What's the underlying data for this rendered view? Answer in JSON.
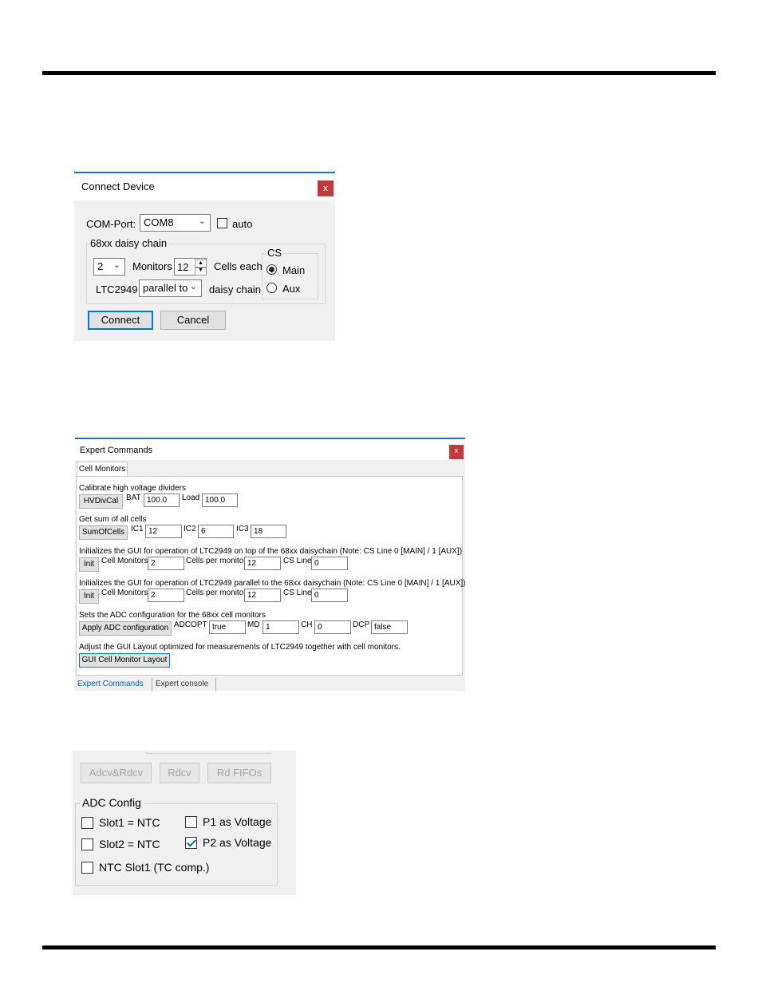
{
  "connect_device": {
    "title": "Connect Device",
    "close": "x",
    "com_port_label": "COM-Port:",
    "com_port_value": "COM8",
    "auto_label": "auto",
    "auto_checked": false,
    "daisy_group_label": "68xx daisy chain",
    "monitors_value": "2",
    "monitors_label": "Monitors",
    "cells_value": "12",
    "cells_label": "Cells each",
    "ltc_label": "LTC2949",
    "ltc_mode_value": "parallel to",
    "daisy_chain_label": "daisy chain",
    "cs_group_label": "CS",
    "cs_main_label": "Main",
    "cs_aux_label": "Aux",
    "cs_selected": "Main",
    "connect_button": "Connect",
    "cancel_button": "Cancel"
  },
  "expert_commands": {
    "title": "Expert Commands",
    "close": "x",
    "tab_cell_monitors": "Cell Monitors",
    "hvdiv": {
      "desc": "Calibrate high voltage dividers",
      "button": "HVDivCal",
      "bat_label": "BAT",
      "bat_value": "100.0",
      "load_label": "Load",
      "load_value": "100.0"
    },
    "sum": {
      "desc": "Get sum of all cells",
      "button": "SumOfCells",
      "ic1_label": "IC1",
      "ic1_value": "12",
      "ic2_label": "IC2",
      "ic2_value": "6",
      "ic3_label": "IC3",
      "ic3_value": "18"
    },
    "init_top": {
      "desc": "Initializes the GUI for operation of LTC2949 on top of the 68xx daisychain (Note: CS Line 0 [MAIN] / 1 [AUX])",
      "button": "Init",
      "cell_monitors_label": "Cell Monitors",
      "cell_monitors_value": "2",
      "cells_per_monitor_label": "Cells per monitor",
      "cells_per_monitor_value": "12",
      "cs_line_label": "CS Line",
      "cs_line_value": "0"
    },
    "init_parallel": {
      "desc": "Initializes the GUI for operation of LTC2949 parallel to the 68xx daisychain (Note: CS Line 0 [MAIN] / 1 [AUX])",
      "button": "Init",
      "cell_monitors_label": "Cell Monitors",
      "cell_monitors_value": "2",
      "cells_per_monitor_label": "Cells per monitor",
      "cells_per_monitor_value": "12",
      "cs_line_label": "CS Line",
      "cs_line_value": "0"
    },
    "adc": {
      "desc": "Sets the ADC configuration for the 68xx cell monitors",
      "button": "Apply ADC configuration",
      "adcopt_label": "ADCOPT",
      "adcopt_value": "true",
      "md_label": "MD",
      "md_value": "1",
      "ch_label": "CH",
      "ch_value": "0",
      "dcp_label": "DCP",
      "dcp_value": "false"
    },
    "layout": {
      "desc": "Adjust the GUI Layout optimized for measurements of LTC2949 together with cell monitors.",
      "button": "GUI Cell Monitor Layout"
    },
    "bottom_tabs": [
      "Expert Commands",
      "Expert console"
    ],
    "active_bottom_tab": "Expert Commands"
  },
  "adc_panel": {
    "buttons": [
      "Adcv&Rdcv",
      "Rdcv",
      "Rd FIFOs"
    ],
    "group_label": "ADC Config",
    "slot1_ntc": "Slot1 = NTC",
    "slot2_ntc": "Slot2 = NTC",
    "ntc_slot1_tc": "NTC Slot1 (TC comp.)",
    "p1_voltage": "P1 as Voltage",
    "p2_voltage": "P2 as Voltage",
    "checked": [
      "P2 as Voltage"
    ]
  },
  "colors": {
    "title_accent": "#1e6fc1",
    "close_red": "#c0393b",
    "dialog_bg": "#f0f0f0",
    "active_tab_text": "#0063b1"
  }
}
